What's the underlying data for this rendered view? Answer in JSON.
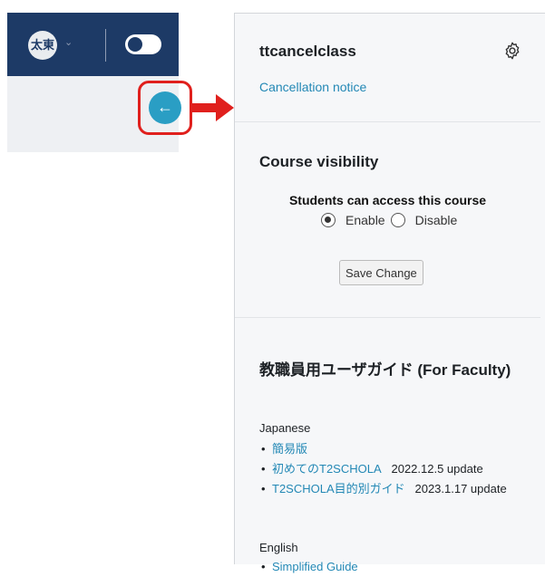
{
  "header": {
    "avatar_initials": "太東",
    "chevron": "⌄",
    "toggle_state": "off"
  },
  "drawer_toggle": {
    "icon": "←"
  },
  "course": {
    "name": "ttcancelclass",
    "cancel_link": "Cancellation notice"
  },
  "visibility": {
    "title": "Course visibility",
    "subtitle": "Students can access this course",
    "enable_label": "Enable",
    "disable_label": "Disable",
    "selected": "Enable",
    "save_label": "Save Change"
  },
  "guide": {
    "title": "教職員用ユーザガイド (For Faculty)",
    "japanese_label": "Japanese",
    "japanese_items": [
      {
        "link": "簡易版",
        "note": ""
      },
      {
        "link": "初めてのT2SCHOLA",
        "note": "2022.12.5 update"
      },
      {
        "link": "T2SCHOLA目的別ガイド",
        "note": "2023.1.17 update"
      }
    ],
    "english_label": "English",
    "english_items": [
      {
        "link": "Simplified Guide",
        "note": ""
      }
    ]
  },
  "colors": {
    "navbar": "#1d3a66",
    "accent": "#2a9ec4",
    "highlight": "#e0201d",
    "link": "#2388b5"
  }
}
